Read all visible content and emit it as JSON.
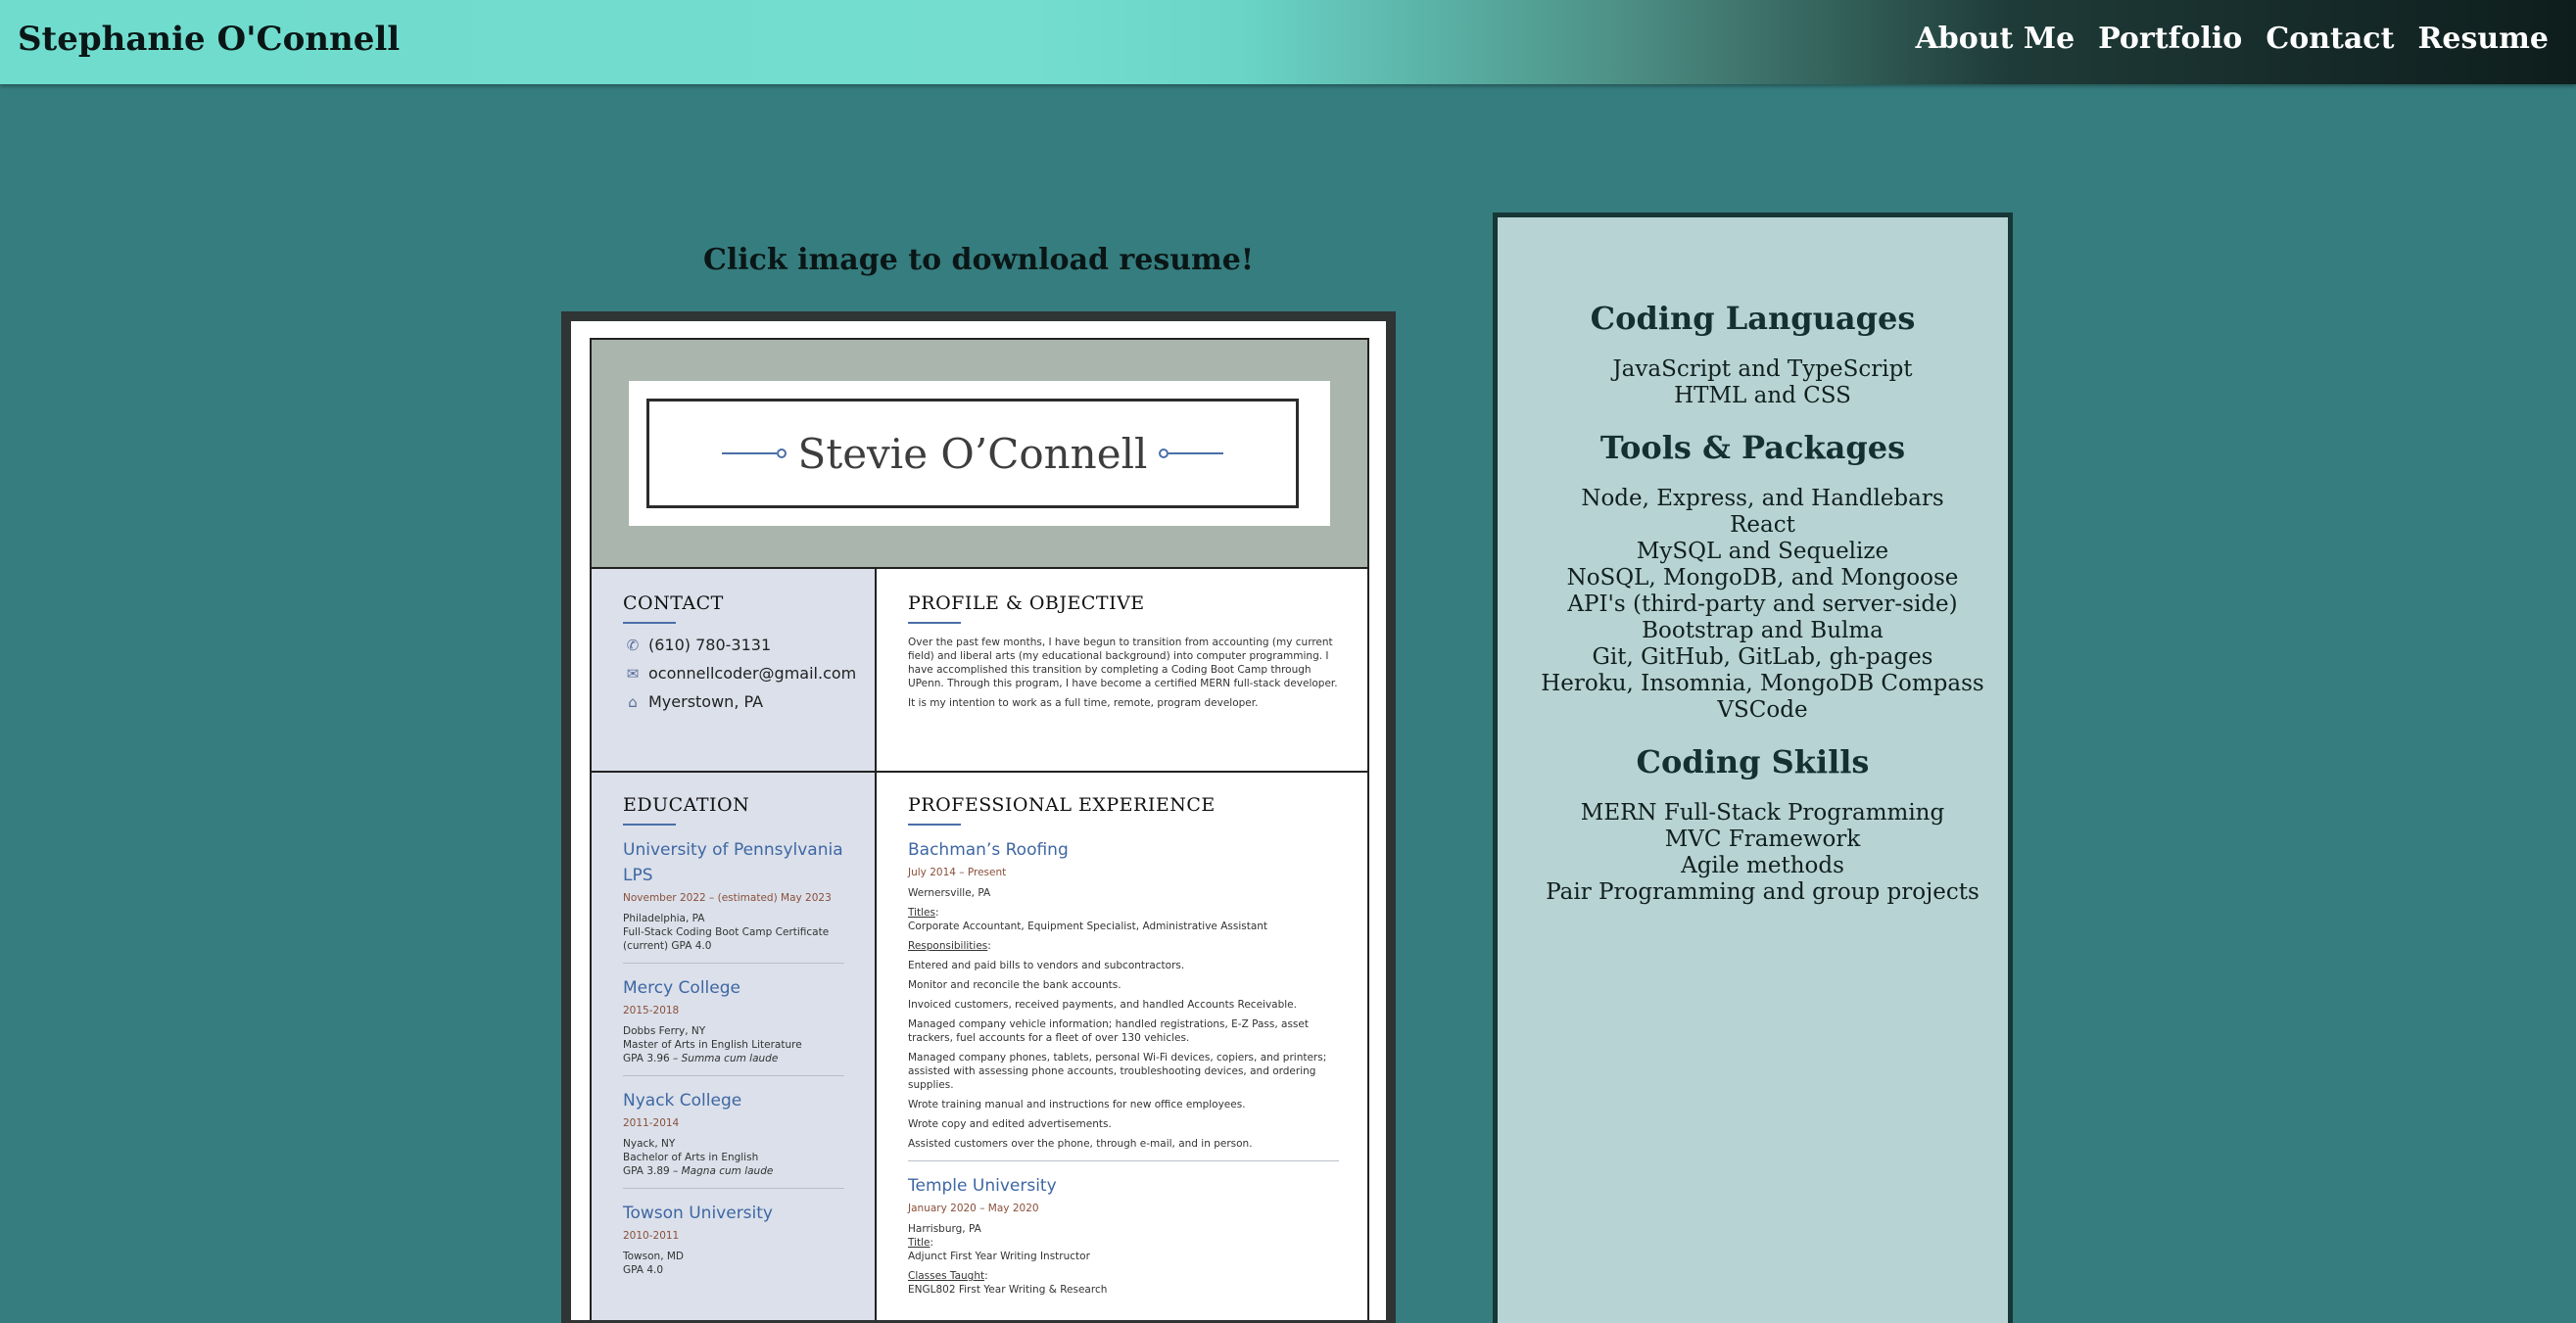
{
  "header": {
    "site_title": "Stephanie O'Connell",
    "nav": [
      "About Me",
      "Portfolio",
      "Contact",
      "Resume"
    ]
  },
  "resume": {
    "download_heading": "Click image to download resume!",
    "name": "Stevie O’Connell",
    "contact": {
      "title": "CONTACT",
      "phone": "(610) 780-3131",
      "email": "oconnellcoder@gmail.com",
      "location": "Myerstown, PA",
      "icons": [
        "phone-icon",
        "mail-icon",
        "home-icon"
      ]
    },
    "profile": {
      "title": "PROFILE & OBJECTIVE",
      "p1": "Over the past few months, I have begun to transition from accounting (my current field) and liberal arts (my educational background) into computer programming. I have accomplished this transition by completing a Coding Boot Camp through UPenn. Through this program, I have become a certified MERN full-stack developer.",
      "p2": "It is my intention to work as a full time, remote, program developer."
    },
    "education": {
      "title": "EDUCATION",
      "schools": [
        {
          "name": "University of Pennsylvania LPS",
          "dates": "November 2022 – (estimated) May 2023",
          "place": "Philadelphia, PA",
          "detail1": "Full-Stack Coding Boot Camp Certificate",
          "detail2": "(current) GPA 4.0",
          "honor": ""
        },
        {
          "name": "Mercy College",
          "dates": "2015-2018",
          "place": "Dobbs Ferry, NY",
          "detail1": "Master of Arts in English Literature",
          "detail2": "GPA 3.96 – ",
          "honor": "Summa cum laude"
        },
        {
          "name": "Nyack College",
          "dates": "2011-2014",
          "place": "Nyack, NY",
          "detail1": "Bachelor of Arts in English",
          "detail2": "GPA 3.89 – ",
          "honor": "Magna cum laude"
        },
        {
          "name": "Towson University",
          "dates": "2010-2011",
          "place": "Towson, MD",
          "detail1": "GPA 4.0",
          "detail2": "",
          "honor": ""
        }
      ]
    },
    "experience": {
      "title": "PROFESSIONAL EXPERIENCE",
      "jobs": [
        {
          "org": "Bachman’s Roofing",
          "dates": "July 2014 – Present",
          "place": "Wernersville, PA",
          "titles_label": "Titles",
          "titles": "Corporate Accountant, Equipment Specialist, Administrative Assistant",
          "resp_label": "Responsibilities",
          "bullets": [
            "Entered and paid bills to vendors and subcontractors.",
            "Monitor and reconcile the bank accounts.",
            "Invoiced customers, received payments, and handled Accounts Receivable.",
            "Managed company vehicle information; handled registrations, E-Z Pass, asset trackers, fuel accounts for a fleet of over 130 vehicles.",
            "Managed company phones, tablets, personal Wi-Fi devices, copiers, and printers; assisted with assessing phone accounts, troubleshooting devices, and ordering supplies.",
            "Wrote training manual and instructions for new office employees.",
            "Wrote copy and edited advertisements.",
            "Assisted customers over the phone, through e-mail, and in person."
          ]
        },
        {
          "org": "Temple University",
          "dates": "January 2020 – May 2020",
          "place": "Harrisburg, PA",
          "title_label": "Title",
          "title": "Adjunct First Year Writing Instructor",
          "classes_label": "Classes Taught",
          "classes": "ENGL802 First Year Writing & Research"
        }
      ]
    }
  },
  "skills": {
    "languages_title": "Coding Languages",
    "languages": [
      "JavaScript and TypeScript",
      "HTML and CSS"
    ],
    "tools_title": "Tools & Packages",
    "tools": [
      "Node, Express, and Handlebars",
      "React",
      "MySQL and Sequelize",
      "NoSQL, MongoDB, and Mongoose",
      "API's (third-party and server-side)",
      "Bootstrap and Bulma",
      "Git, GitHub, GitLab, gh-pages",
      "Heroku, Insomnia, MongoDB Compass",
      "VSCode"
    ],
    "skills_title": "Coding Skills",
    "skills": [
      "MERN Full-Stack Programming",
      "MVC Framework",
      "Agile methods",
      "Pair Programming and group projects"
    ]
  }
}
